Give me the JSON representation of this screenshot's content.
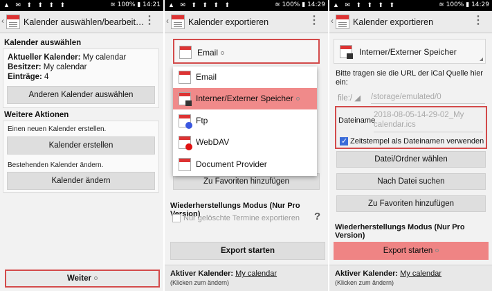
{
  "status": {
    "left_icons": "▲ ✉ ⬆ ⬆ ⬆ ⬆",
    "battery": "100%",
    "times": [
      "14:21",
      "14:29",
      "14:29"
    ]
  },
  "screen1": {
    "title": "Kalender auswählen/bearbeit…",
    "section_select": "Kalender auswählen",
    "current_label": "Aktueller Kalender:",
    "current_value": "My calendar",
    "owner_label": "Besitzer:",
    "owner_value": "My calendar",
    "entries_label": "Einträge:",
    "entries_value": "4",
    "select_other_button": "Anderen Kalender auswählen",
    "section_more": "Weitere Aktionen",
    "create_text": "Einen neuen Kalender erstellen.",
    "create_button": "Kalender erstellen",
    "edit_text": "Bestehenden Kalender ändern.",
    "edit_button": "Kalender ändern",
    "next_button": "Weiter"
  },
  "screen2": {
    "title": "Kalender exportieren",
    "selected_target": "Email",
    "dropdown": [
      {
        "label": "Email",
        "icon": "email-icon",
        "selected": false
      },
      {
        "label": "Interner/Externer Speicher",
        "icon": "storage-icon",
        "selected": true
      },
      {
        "label": "Ftp",
        "icon": "ftp-icon",
        "selected": false
      },
      {
        "label": "WebDAV",
        "icon": "webdav-icon",
        "selected": false
      },
      {
        "label": "Document Provider",
        "icon": "document-provider-icon",
        "selected": false
      }
    ],
    "favorites_button": "Zu Favoriten hinzufügen",
    "restore_mode": "Wiederherstellungs Modus (Nur Pro Version)",
    "only_deleted": "Nur gelöschte Termine exportieren",
    "help": "?",
    "export_button": "Export starten",
    "active_label": "Aktiver Kalender:",
    "active_value": "My calendar",
    "active_hint": "(Klicken zum ändern)"
  },
  "screen3": {
    "title": "Kalender exportieren",
    "selected_target": "Interner/Externer Speicher",
    "url_hint": "Bitte tragen sie die URL der iCal Quelle hier ein:",
    "scheme": "file:/",
    "path": "/storage/emulated/0",
    "filename_label": "Dateiname",
    "filename_value": "2018-08-05-14-29-02_My calendar.ics",
    "timestamp_checkbox": "Zeitstempel als Dateinamen verwenden",
    "choose_button": "Datei/Ordner wählen",
    "search_button": "Nach Datei suchen",
    "favorites_button": "Zu Favoriten hinzufügen",
    "restore_mode": "Wiederherstellungs Modus (Nur Pro Version)",
    "export_button": "Export starten",
    "active_label": "Aktiver Kalender:",
    "active_value": "My calendar",
    "active_hint": "(Klicken zum ändern)"
  }
}
